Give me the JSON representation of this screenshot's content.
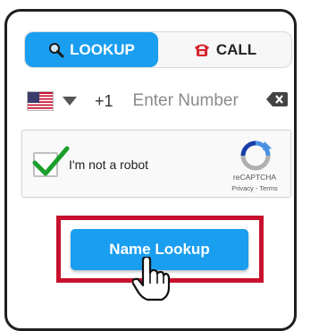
{
  "tabs": [
    {
      "label": "LOOKUP",
      "icon": "magnifier-icon",
      "active": true
    },
    {
      "label": "CALL",
      "icon": "telephone-icon",
      "active": false
    }
  ],
  "phone": {
    "country_flag": "us-flag-icon",
    "country_code": "+1",
    "placeholder": "Enter Number",
    "value": ""
  },
  "captcha": {
    "checked": true,
    "label": "I'm not a robot",
    "brand": "reCAPTCHA",
    "links": "Privacy - Terms"
  },
  "action": {
    "label": "Name Lookup"
  },
  "colors": {
    "accent": "#1a9ef0",
    "highlight": "#c8102e",
    "check": "#1a9e2b"
  }
}
